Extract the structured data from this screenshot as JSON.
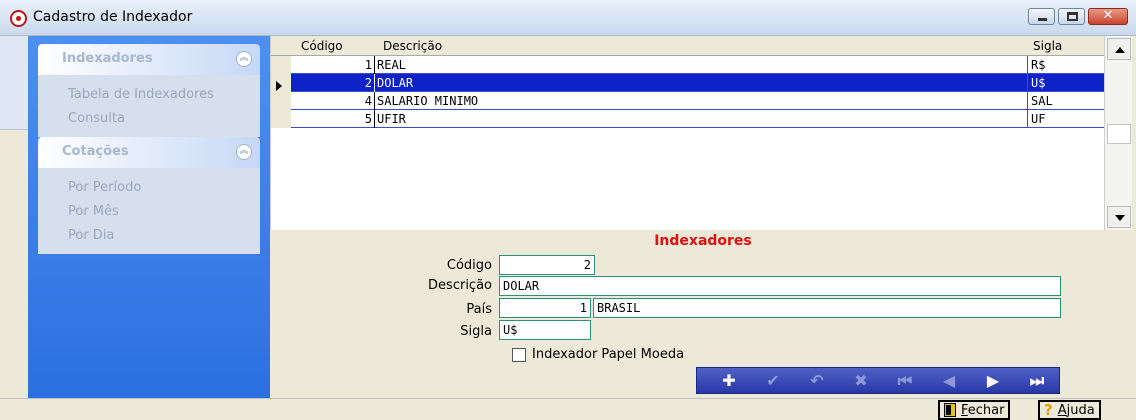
{
  "window": {
    "title": "Cadastro de Indexador"
  },
  "sidebar": {
    "groups": [
      {
        "title": "Indexadores",
        "items": [
          "Tabela de Indexadores",
          "Consulta"
        ]
      },
      {
        "title": "Cotações",
        "items": [
          "Por Período",
          "Por Mês",
          "Por Dia"
        ]
      }
    ]
  },
  "grid": {
    "columns": [
      "Código",
      "Descrição",
      "Sigla"
    ],
    "rows": [
      {
        "codigo": "1",
        "descricao": "REAL",
        "sigla": "R$"
      },
      {
        "codigo": "2",
        "descricao": "DOLAR",
        "sigla": "U$"
      },
      {
        "codigo": "4",
        "descricao": "SALARIO MINIMO",
        "sigla": "SAL"
      },
      {
        "codigo": "5",
        "descricao": "UFIR",
        "sigla": "UF"
      }
    ],
    "selected_row": 1
  },
  "form": {
    "title": "Indexadores",
    "codigo_label": "Código",
    "codigo_value": "2",
    "descricao_label": "Descrição",
    "descricao_value": "DOLAR",
    "pais_label": "País",
    "pais_code": "1",
    "pais_name": "BRASIL",
    "sigla_label": "Sigla",
    "sigla_value": "U$",
    "checkbox_label": "Indexador Papel Moeda",
    "checkbox_checked": false
  },
  "navigator": {
    "buttons": [
      {
        "name": "insert",
        "glyph": "✚",
        "enabled": true
      },
      {
        "name": "post",
        "glyph": "✔",
        "enabled": false
      },
      {
        "name": "cancel",
        "glyph": "↶",
        "enabled": false
      },
      {
        "name": "delete",
        "glyph": "✖",
        "enabled": false
      },
      {
        "name": "first",
        "glyph": "⏮",
        "enabled": false
      },
      {
        "name": "prior",
        "glyph": "◀",
        "enabled": false
      },
      {
        "name": "next",
        "glyph": "▶",
        "enabled": true
      },
      {
        "name": "last",
        "glyph": "⏭",
        "enabled": true
      }
    ]
  },
  "statusbar": {
    "close_label_underlined": "F",
    "close_label_rest": "echar",
    "help_label_underlined": "A",
    "help_label_rest": "juda"
  },
  "icons": {
    "title": "target-icon",
    "close": "door-icon",
    "help": "question-icon"
  }
}
